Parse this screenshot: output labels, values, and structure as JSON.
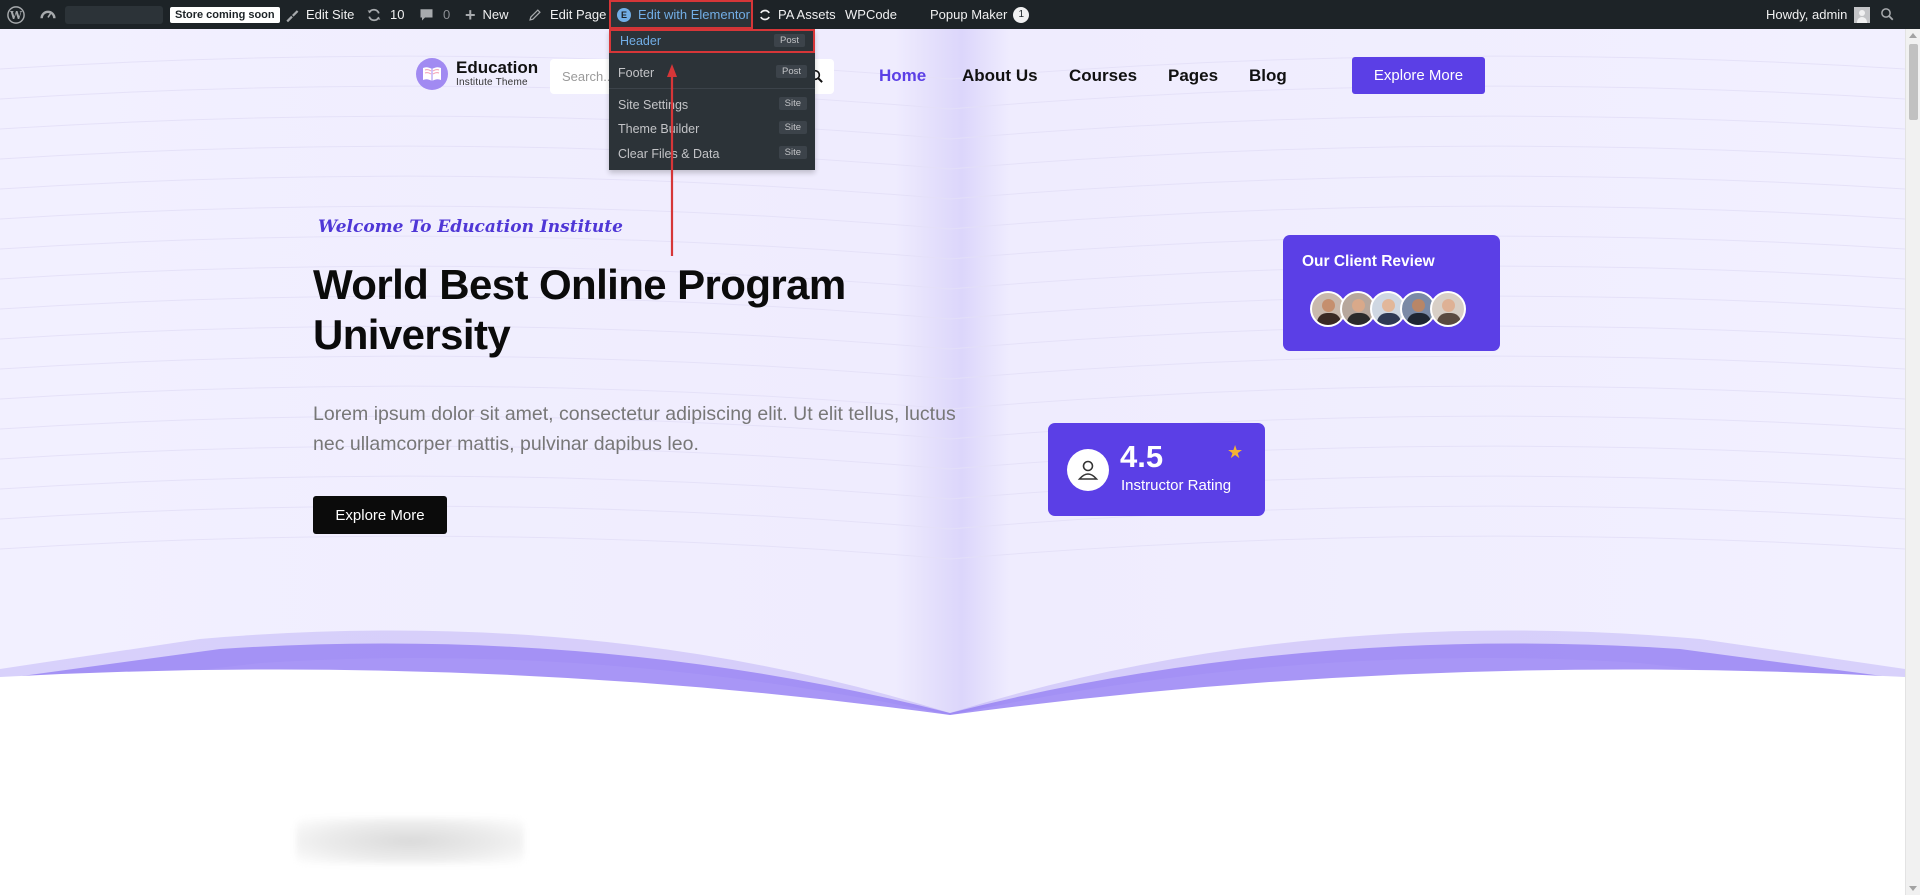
{
  "admin_bar": {
    "store_badge": "Store coming soon",
    "edit_site": "Edit Site",
    "updates_count": "10",
    "comments_count": "0",
    "new_label": "New",
    "edit_page": "Edit Page",
    "edit_with_elementor": "Edit with Elementor",
    "pa_assets": "PA Assets",
    "wpcode": "WPCode",
    "popup_maker": "Popup Maker",
    "popup_maker_count": "1",
    "greeting": "Howdy, admin"
  },
  "elementor_menu": {
    "items": [
      {
        "label": "Header",
        "tag": "Post"
      },
      {
        "label": "Footer",
        "tag": "Post"
      },
      {
        "label": "Site Settings",
        "tag": "Site"
      },
      {
        "label": "Theme Builder",
        "tag": "Site"
      },
      {
        "label": "Clear Files & Data",
        "tag": "Site"
      }
    ]
  },
  "site": {
    "logo_title": "Education",
    "logo_subtitle": "Institute Theme",
    "search_placeholder": "Search...",
    "nav": [
      "Home",
      "About Us",
      "Courses",
      "Pages",
      "Blog"
    ],
    "header_button": "Explore More"
  },
  "hero": {
    "welcome": "Welcome To Education Institute",
    "title_line1": "World Best Online Program",
    "title_line2": "University",
    "lede": "Lorem ipsum dolor sit amet, consectetur adipiscing elit. Ut elit tellus, luctus nec ullamcorper mattis, pulvinar dapibus leo.",
    "cta": "Explore More"
  },
  "review_card": {
    "title": "Our Client Review"
  },
  "rating_card": {
    "value": "4.5",
    "label": "Instructor Rating",
    "star": "★"
  },
  "colors": {
    "accent": "#5b3fe6",
    "admin_bar": "#1d2327",
    "highlight_border": "#d63638",
    "star": "#f5b335"
  }
}
